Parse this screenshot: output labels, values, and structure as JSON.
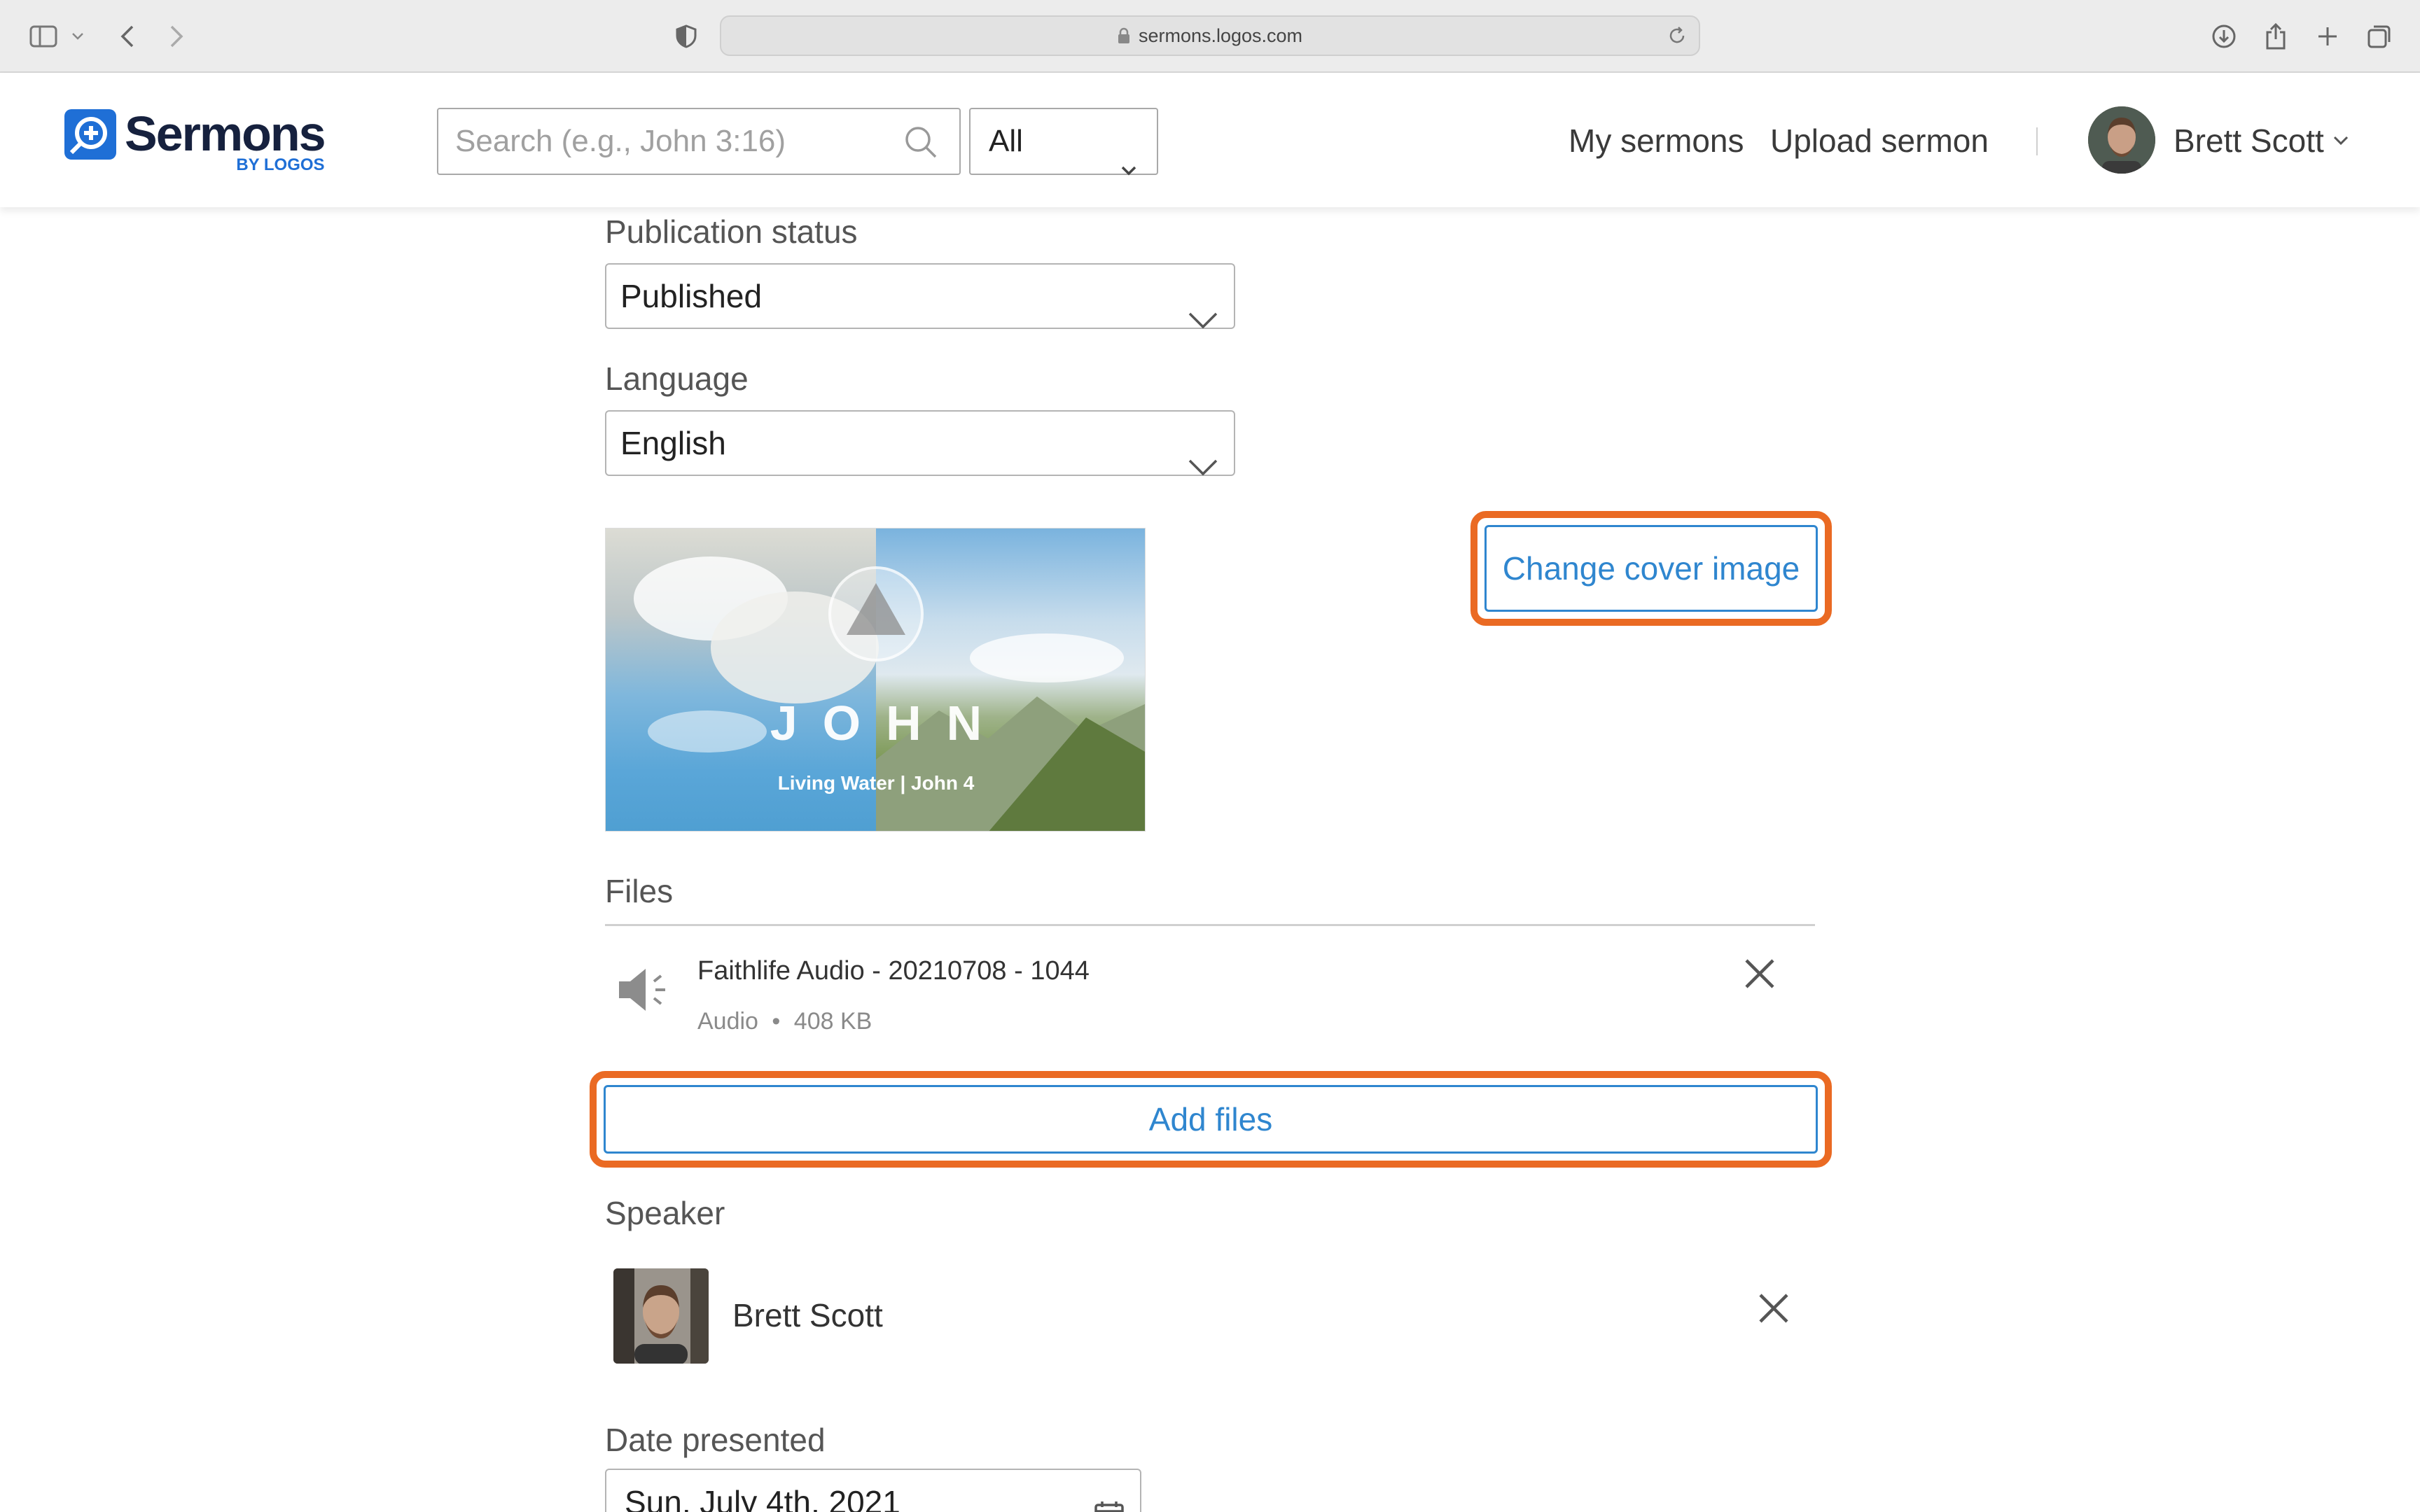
{
  "browser": {
    "url": "sermons.logos.com"
  },
  "header": {
    "logo_word": "Sermons",
    "logo_sub": "BY LOGOS",
    "search_placeholder": "Search (e.g., John 3:16)",
    "filter_value": "All",
    "nav": {
      "my_sermons": "My sermons",
      "upload_sermon": "Upload sermon"
    },
    "user_name": "Brett Scott"
  },
  "form": {
    "publication_status": {
      "label": "Publication status",
      "value": "Published"
    },
    "language": {
      "label": "Language",
      "value": "English"
    },
    "cover": {
      "title": "JOHN",
      "subtitle": "Living Water | John 4",
      "change_button": "Change cover image"
    },
    "files": {
      "label": "Files",
      "items": [
        {
          "name": "Faithlife Audio - 20210708 - 1044",
          "type": "Audio",
          "separator": "•",
          "size": "408 KB"
        }
      ],
      "add_button": "Add files"
    },
    "speaker": {
      "label": "Speaker",
      "name": "Brett Scott"
    },
    "date_presented": {
      "label": "Date presented",
      "value": "Sun, July 4th, 2021"
    }
  },
  "colors": {
    "accent": "#2f86cf",
    "highlight": "#ea6a23",
    "brand_blue": "#1f6fd6",
    "brand_dark": "#16213e"
  }
}
